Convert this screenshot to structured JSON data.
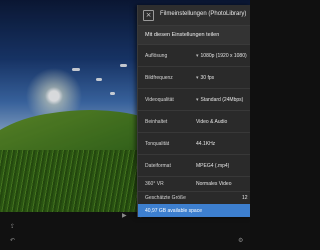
{
  "panel": {
    "title": "Filmeinstellungen (PhotoLibrary)",
    "close_icon": "×",
    "share_label": "Mit diesen Einstellungen teilen",
    "rows": [
      {
        "label": "Auflösung",
        "value": "1080p (1920 x 1080)",
        "chevron": true
      },
      {
        "label": "Bildfrequenz",
        "value": "30 fps",
        "chevron": true
      },
      {
        "label": "Videoqualität",
        "value": "Standard (24Mbps)",
        "chevron": true
      },
      {
        "label": "Beinhaltet",
        "value": "Video & Audio",
        "chevron": false
      },
      {
        "label": "Tonqualität",
        "value": "44.1KHz",
        "chevron": false
      },
      {
        "label": "Dateiformat",
        "value": "MPEG4 (.mp4)",
        "chevron": false
      },
      {
        "label": "360° VR",
        "value": "Normales Video",
        "chevron": false
      },
      {
        "label": "Geschätzte Größe",
        "value": "12",
        "chevron": false
      }
    ],
    "chevron_glyph": "▾",
    "storage_text": "40,97 GB available space"
  },
  "toolbar": {
    "icons": [
      "share-icon",
      "undo-icon",
      "play-icon",
      "fullscreen-icon",
      "settings-icon"
    ]
  },
  "colors": {
    "panel_bg": "#2a2a2a",
    "accent": "#3d7fcf"
  }
}
